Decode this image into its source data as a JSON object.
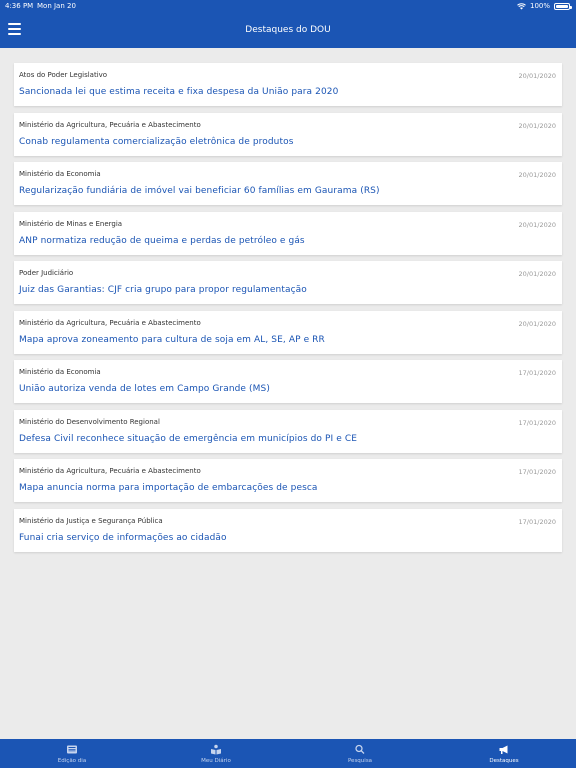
{
  "status_bar": {
    "time": "4:36 PM",
    "date": "Mon Jan 20",
    "battery": "100%"
  },
  "header": {
    "title": "Destaques do DOU",
    "menu_icon": "hamburger-menu-icon"
  },
  "items": [
    {
      "org": "Atos do Poder Legislativo",
      "date": "20/01/2020",
      "headline": "Sancionada lei que estima receita e fixa despesa da União para 2020"
    },
    {
      "org": "Ministério da Agricultura, Pecuária e Abastecimento",
      "date": "20/01/2020",
      "headline": "Conab regulamenta comercialização eletrônica de produtos"
    },
    {
      "org": "Ministério da Economia",
      "date": "20/01/2020",
      "headline": "Regularização fundiária de imóvel vai beneficiar 60 famílias em Gaurama (RS)"
    },
    {
      "org": "Ministério de Minas e Energia",
      "date": "20/01/2020",
      "headline": "ANP normatiza redução de queima e perdas de petróleo e gás"
    },
    {
      "org": "Poder Judiciário",
      "date": "20/01/2020",
      "headline": "Juiz das Garantias: CJF cria grupo para propor regulamentação"
    },
    {
      "org": "Ministério da Agricultura, Pecuária e Abastecimento",
      "date": "20/01/2020",
      "headline": "Mapa aprova zoneamento para cultura de soja em AL, SE, AP e RR"
    },
    {
      "org": "Ministério da Economia",
      "date": "17/01/2020",
      "headline": "União autoriza venda de lotes em Campo Grande (MS)"
    },
    {
      "org": "Ministério do Desenvolvimento Regional",
      "date": "17/01/2020",
      "headline": "Defesa Civil reconhece situação de emergência em municípios do PI e CE"
    },
    {
      "org": "Ministério da Agricultura, Pecuária e Abastecimento",
      "date": "17/01/2020",
      "headline": "Mapa anuncia norma para importação de embarcações de pesca"
    },
    {
      "org": "Ministério da Justiça e Segurança Pública",
      "date": "17/01/2020",
      "headline": "Funai cria serviço de informações ao cidadão"
    }
  ],
  "tabs": [
    {
      "label": "Edição dia",
      "icon": "newspaper-icon",
      "active": false
    },
    {
      "label": "Meu Diário",
      "icon": "reader-icon",
      "active": false
    },
    {
      "label": "Pesquisa",
      "icon": "search-icon",
      "active": false
    },
    {
      "label": "Destaques",
      "icon": "megaphone-icon",
      "active": true
    }
  ],
  "colors": {
    "primary": "#1b55b4",
    "background": "#ebebeb",
    "card": "#ffffff",
    "headline": "#1b55b4",
    "date": "#999999"
  }
}
